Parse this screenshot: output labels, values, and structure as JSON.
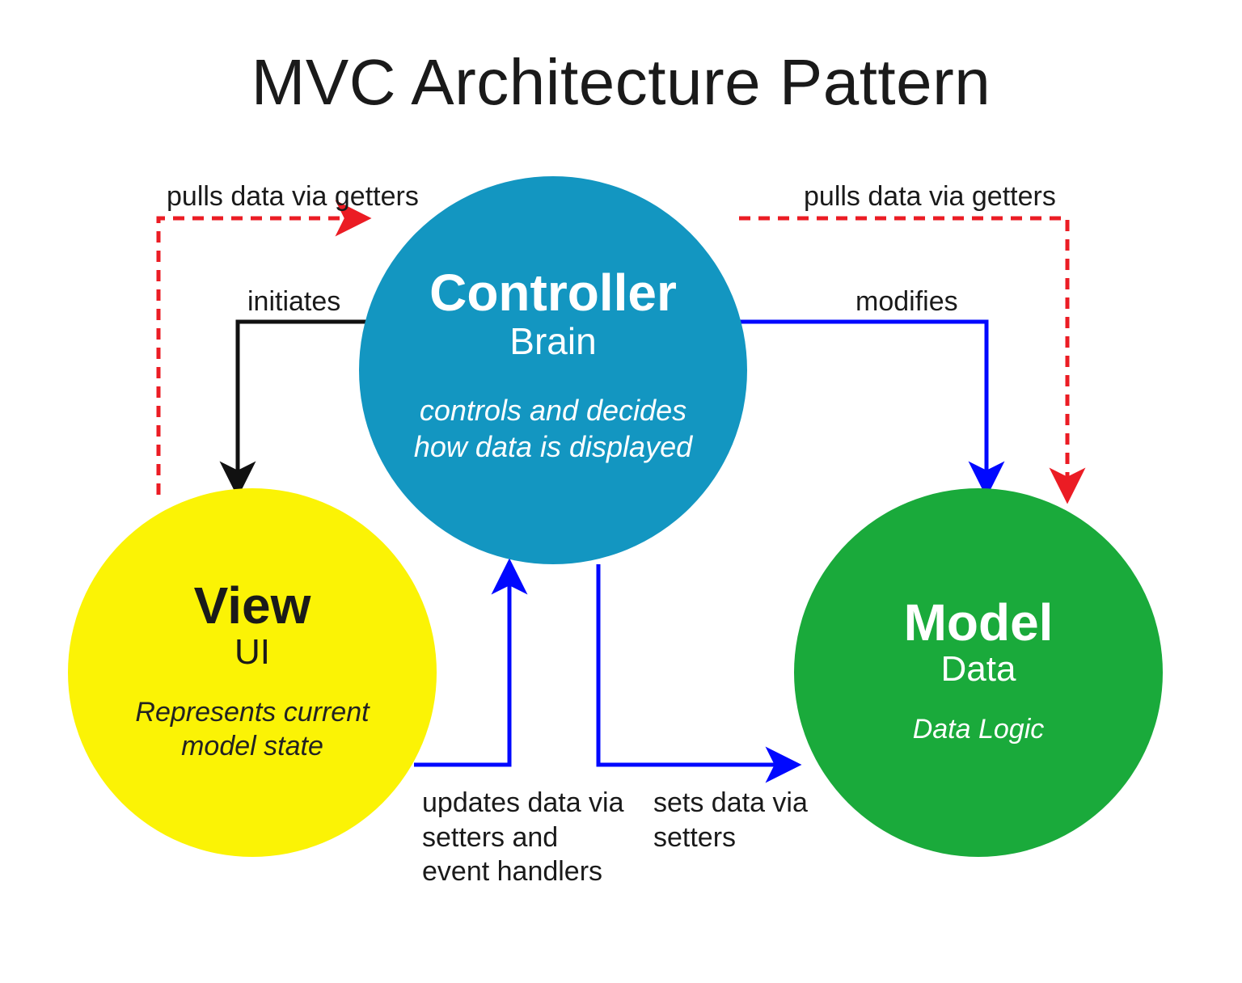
{
  "title": "MVC Architecture Pattern",
  "nodes": {
    "controller": {
      "title": "Controller",
      "subtitle": "Brain",
      "description": "controls and decides how data is displayed"
    },
    "view": {
      "title": "View",
      "subtitle": "UI",
      "description": "Represents current model state"
    },
    "model": {
      "title": "Model",
      "subtitle": "Data",
      "description": "Data Logic"
    }
  },
  "edges": {
    "controller_to_view": "initiates",
    "controller_to_model": "modifies",
    "view_to_controller": "updates data via setters and event handlers",
    "controller_sets_model": "sets data via setters",
    "view_pulls": "pulls data via getters",
    "model_pulls": "pulls data via getters"
  },
  "colors": {
    "controller": "#1396C1",
    "view": "#FBF305",
    "model": "#1AAA3B",
    "solid_black": "#111111",
    "solid_blue": "#0008FF",
    "dashed_red": "#EB1C24"
  }
}
